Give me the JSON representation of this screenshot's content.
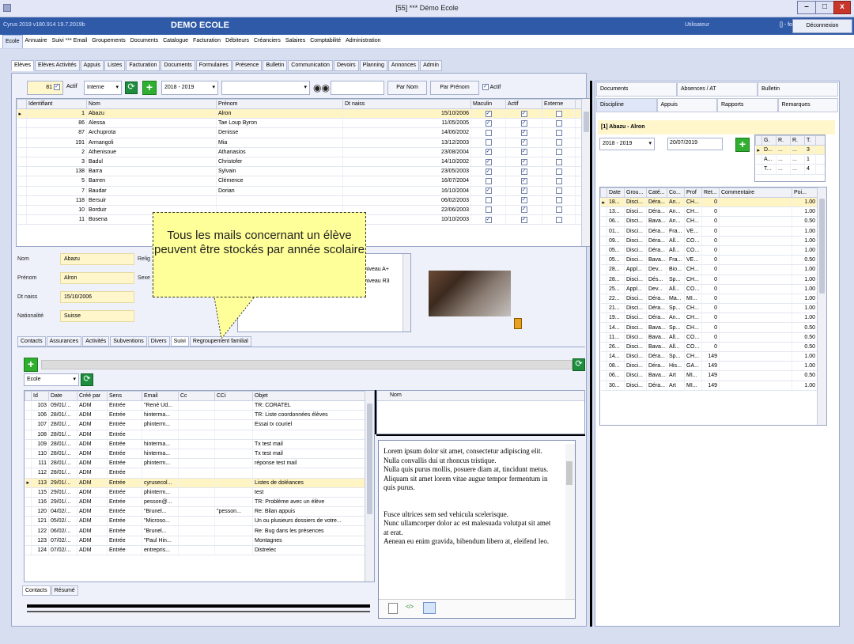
{
  "window": {
    "title": "[55] *** Démo Ecole",
    "min": "–",
    "max": "□",
    "close": "x"
  },
  "appbar": {
    "version": "Cyrus 2019 v180.914 19.7.2019b",
    "school": "DEMO ECOLE",
    "user_label": "Utilisateur",
    "user_value": "[] - fo",
    "logout": "Déconnexion"
  },
  "menu": [
    "Ecole",
    "Annuaire",
    "Suivi *** Email",
    "Groupements",
    "Documents",
    "Catalogue",
    "Facturation",
    "Débiteurs",
    "Créanciers",
    "Salaires",
    "Comptabilité",
    "Administration"
  ],
  "subtabs": [
    "Elèves",
    "Elèves Activités",
    "Appuis",
    "Listes",
    "Facturation",
    "Documents",
    "Formulaires",
    "Présence",
    "Bulletin",
    "Communication",
    "Devoirs",
    "Planning",
    "Annonces",
    "Admin"
  ],
  "toolbar": {
    "count": "81",
    "actif_label": "Actif",
    "type_value": "Interne",
    "year": "2018 - 2019",
    "by_name": "Par Nom",
    "by_firstname": "Par Prénom",
    "actif2": "Actif"
  },
  "students": {
    "headers": [
      "Identifiant",
      "Nom",
      "Prénom",
      "Dt naiss",
      "Maculin",
      "Actif",
      "Externe"
    ],
    "rows": [
      {
        "id": "1",
        "nom": "Abazu",
        "prenom": "Alron",
        "naiss": "15/10/2006",
        "m": true,
        "a": true,
        "e": false
      },
      {
        "id": "86",
        "nom": "Alessa",
        "prenom": "Tae Loup Byron",
        "naiss": "11/05/2005",
        "m": true,
        "a": true,
        "e": false
      },
      {
        "id": "87",
        "nom": "Archuprota",
        "prenom": "Denisse",
        "naiss": "14/06/2002",
        "m": false,
        "a": true,
        "e": false
      },
      {
        "id": "191",
        "nom": "Armangoli",
        "prenom": "Mia",
        "naiss": "13/12/2003",
        "m": false,
        "a": true,
        "e": false
      },
      {
        "id": "2",
        "nom": "Athenisoue",
        "prenom": "Athanasios",
        "naiss": "23/08/2004",
        "m": true,
        "a": true,
        "e": false
      },
      {
        "id": "3",
        "nom": "Badul",
        "prenom": "Christofer",
        "naiss": "14/10/2002",
        "m": true,
        "a": true,
        "e": false
      },
      {
        "id": "138",
        "nom": "Barra",
        "prenom": "Sylvain",
        "naiss": "23/05/2003",
        "m": true,
        "a": true,
        "e": false
      },
      {
        "id": "5",
        "nom": "Barren",
        "prenom": "Clémence",
        "naiss": "16/07/2004",
        "m": false,
        "a": true,
        "e": false
      },
      {
        "id": "7",
        "nom": "Baudar",
        "prenom": "Dorian",
        "naiss": "16/10/2004",
        "m": true,
        "a": true,
        "e": false
      },
      {
        "id": "118",
        "nom": "Bersuir",
        "prenom": "",
        "naiss": "06/02/2003",
        "m": false,
        "a": true,
        "e": false
      },
      {
        "id": "10",
        "nom": "Borduir",
        "prenom": "",
        "naiss": "22/06/2003",
        "m": false,
        "a": true,
        "e": false
      },
      {
        "id": "11",
        "nom": "Bosena",
        "prenom": "",
        "naiss": "10/10/2003",
        "m": true,
        "a": true,
        "e": false
      }
    ]
  },
  "detail": {
    "nom_label": "Nom",
    "nom": "Abazu",
    "prenom_label": "Prénom",
    "prenom": "Alron",
    "naiss_label": "Dt naiss",
    "naiss": "15/10/2006",
    "nat_label": "Nationalité",
    "nat": "Suisse",
    "relig_label": "Relig",
    "sexe_label": "Sexe",
    "level_header": "e",
    "levels": [
      "niveau A+",
      "niveau R3"
    ]
  },
  "callout": {
    "text": "Tous les mails concernant un élève peuvent être stockés par année scolaire"
  },
  "detailtabs": [
    "Contacts",
    "Assurances",
    "Activités",
    "Subventions",
    "Divers",
    "Suivi",
    "Regroupement familial"
  ],
  "suivi": {
    "filter": "Ecole",
    "headers": [
      "Id",
      "Date",
      "Créé par",
      "Sens",
      "Email",
      "Cc",
      "CCi",
      "Objet"
    ],
    "rows": [
      [
        "103",
        "09/01/...",
        "ADM",
        "Entrée",
        "\"René Ud...",
        "",
        "",
        "TR: CORATEL"
      ],
      [
        "106",
        "28/01/...",
        "ADM",
        "Entrée",
        "hinterma...",
        "",
        "",
        "TR: Liste coordonnées élèves"
      ],
      [
        "107",
        "28/01/...",
        "ADM",
        "Entrée",
        "phinterm...",
        "",
        "",
        "Essai tx couriel"
      ],
      [
        "108",
        "28/01/...",
        "ADM",
        "Entrée",
        "",
        "",
        "",
        ""
      ],
      [
        "109",
        "28/01/...",
        "ADM",
        "Entrée",
        "hinterma...",
        "",
        "",
        "Tx test mail"
      ],
      [
        "110",
        "28/01/...",
        "ADM",
        "Entrée",
        "hinterma...",
        "",
        "",
        "Tx test mail"
      ],
      [
        "111",
        "28/01/...",
        "ADM",
        "Entrée",
        "phinterm...",
        "",
        "",
        "réponse test mail"
      ],
      [
        "112",
        "28/01/...",
        "ADM",
        "Entrée",
        "",
        "",
        "",
        ""
      ],
      [
        "113",
        "29/01/...",
        "ADM",
        "Entrée",
        "cyrusecol...",
        "",
        "",
        "Listes de doléances"
      ],
      [
        "115",
        "29/01/...",
        "ADM",
        "Entrée",
        "phinterm...",
        "",
        "",
        "test"
      ],
      [
        "116",
        "29/01/...",
        "ADM",
        "Entrée",
        "pesson@...",
        "",
        "",
        "TR: Problème avec un élève"
      ],
      [
        "120",
        "04/02/...",
        "ADM",
        "Entrée",
        "\"Brunel...",
        "",
        "\"pesson...",
        "Re: Bilan appuis"
      ],
      [
        "121",
        "05/02/...",
        "ADM",
        "Entrée",
        "\"Microso...",
        "",
        "",
        "Un ou plusieurs dossiers de votre..."
      ],
      [
        "122",
        "06/02/...",
        "ADM",
        "Entrée",
        "\"Brunel...",
        "",
        "",
        "Re: Bug dans les présences"
      ],
      [
        "123",
        "07/02/...",
        "ADM",
        "Entrée",
        "\"Paul Hin...",
        "",
        "",
        "Montagnes"
      ],
      [
        "124",
        "07/02/...",
        "ADM",
        "Entrée",
        "entrepris...",
        "",
        "",
        "Distrelec"
      ]
    ],
    "selected": 8,
    "bottom_tabs": [
      "Contacts",
      "Résumé"
    ],
    "nom_header": "Nom"
  },
  "lorem": [
    "Lorem ipsum dolor sit amet, consectetur adipiscing elit.",
    "Nulla convallis dui ut rhoncus tristique.",
    "Nulla quis purus mollis, posuere diam at, tincidunt metus.",
    "Aliquam sit amet lorem vitae augue tempor fermentum in quis purus.",
    "",
    "",
    "Fusce ultrices sem sed vehicula scelerisque.",
    "Nunc ullamcorper dolor ac est malesuada volutpat sit amet at erat.",
    "Aenean eu enim gravida, bibendum libero at, eleifend leo."
  ],
  "right": {
    "tabs1": [
      "Documents",
      "Absences / AT",
      "Bulletin"
    ],
    "tabs2": [
      "Discipline",
      "Appuis",
      "Rapports",
      "Remarques"
    ],
    "student": "[1] Abazu - Alron",
    "year": "2018 - 2019",
    "date": "20/07/2019",
    "mini_headers": [
      "G.",
      "R.",
      "R.",
      "T."
    ],
    "mini_rows": [
      [
        "D...",
        "...",
        "...",
        "3"
      ],
      [
        "A...",
        "...",
        "...",
        "1"
      ],
      [
        "T...",
        "...",
        "...",
        "4"
      ]
    ],
    "headers": [
      "Date",
      "Grou...",
      "Caté...",
      "Co...",
      "Prof",
      "Ret...",
      "Commentaire",
      "Poi..."
    ],
    "rows": [
      [
        "18...",
        "Disci...",
        "Déra...",
        "An...",
        "CH...",
        "0",
        "",
        "1.00"
      ],
      [
        "13...",
        "Disci...",
        "Déra...",
        "An...",
        "CH...",
        "0",
        "",
        "1.00"
      ],
      [
        "06...",
        "Disci...",
        "Bava...",
        "An...",
        "CH...",
        "0",
        "",
        "0.50"
      ],
      [
        "01...",
        "Disci...",
        "Déra...",
        "Fra...",
        "VE...",
        "0",
        "",
        "1.00"
      ],
      [
        "09...",
        "Disci...",
        "Déra...",
        "All...",
        "CO...",
        "0",
        "",
        "1.00"
      ],
      [
        "05...",
        "Disci...",
        "Déra...",
        "All...",
        "CO...",
        "0",
        "",
        "1.00"
      ],
      [
        "05...",
        "Disci...",
        "Bava...",
        "Fra...",
        "VE...",
        "0",
        "",
        "0.50"
      ],
      [
        "28...",
        "Appl...",
        "Dev...",
        "Bio...",
        "CH...",
        "0",
        "",
        "1.00"
      ],
      [
        "28...",
        "Disci...",
        "Dés...",
        "Sp...",
        "CH...",
        "0",
        "",
        "1.00"
      ],
      [
        "25...",
        "Appl...",
        "Dev...",
        "All...",
        "CO...",
        "0",
        "",
        "1.00"
      ],
      [
        "22...",
        "Disci...",
        "Déra...",
        "Ma...",
        "MI...",
        "0",
        "",
        "1.00"
      ],
      [
        "21...",
        "Disci...",
        "Déra...",
        "Sp...",
        "CH...",
        "0",
        "",
        "1.00"
      ],
      [
        "19...",
        "Disci...",
        "Déra...",
        "An...",
        "CH...",
        "0",
        "",
        "1.00"
      ],
      [
        "14...",
        "Disci...",
        "Bava...",
        "Sp...",
        "CH...",
        "0",
        "",
        "0.50"
      ],
      [
        "11...",
        "Disci...",
        "Bava...",
        "All...",
        "CO...",
        "0",
        "",
        "0.50"
      ],
      [
        "26...",
        "Disci...",
        "Bava...",
        "All...",
        "CO...",
        "0",
        "",
        "0.50"
      ],
      [
        "14...",
        "Disci...",
        "Déra...",
        "Sp...",
        "CH...",
        "149",
        "",
        "1.00"
      ],
      [
        "08...",
        "Disci...",
        "Déra...",
        "His...",
        "GA...",
        "149",
        "",
        "1.00"
      ],
      [
        "06...",
        "Disci...",
        "Bava...",
        "Art",
        "MI...",
        "149",
        "",
        "0.50"
      ],
      [
        "30...",
        "Disci...",
        "Déra...",
        "Art",
        "MI...",
        "149",
        "",
        "1.00"
      ]
    ]
  }
}
